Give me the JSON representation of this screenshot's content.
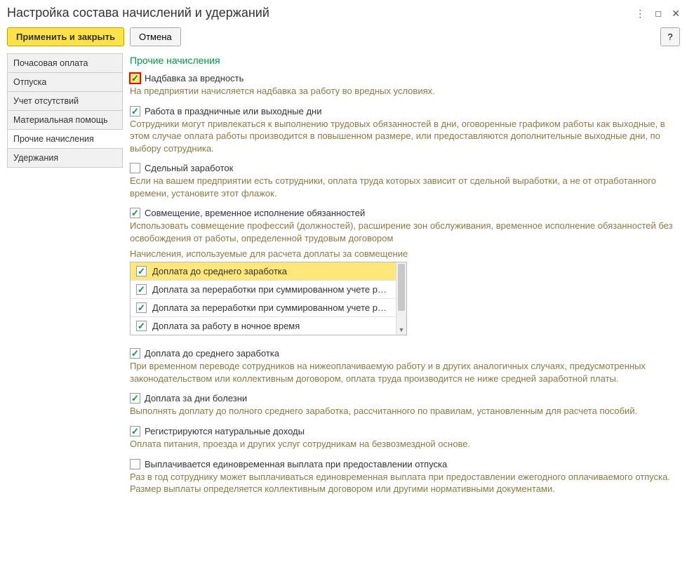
{
  "window": {
    "title": "Настройка состава начислений и удержаний"
  },
  "toolbar": {
    "apply_close": "Применить и закрыть",
    "cancel": "Отмена",
    "help": "?"
  },
  "sidebar": {
    "items": [
      {
        "label": "Почасовая оплата"
      },
      {
        "label": "Отпуска"
      },
      {
        "label": "Учет отсутствий"
      },
      {
        "label": "Материальная помощь"
      },
      {
        "label": "Прочие начисления"
      },
      {
        "label": "Удержания"
      }
    ],
    "active_index": 4
  },
  "main": {
    "heading": "Прочие начисления",
    "hazard": {
      "label": "Надбавка за вредность",
      "checked": true,
      "desc": "На предприятии начисляется надбавка за работу во вредных условиях."
    },
    "holiday": {
      "label": "Работа в праздничные или выходные дни",
      "checked": true,
      "desc": "Сотрудники могут привлекаться к выполнению трудовых обязанностей в дни, оговоренные графиком работы как выходные, в этом случае оплата работы производится в повышенном размере, или предоставляются дополнительные выходные дни, по выбору сотрудника."
    },
    "piecework": {
      "label": "Сдельный заработок",
      "checked": false,
      "desc": "Если на вашем предприятии есть сотрудники, оплата труда которых зависит от сдельной выработки, а не от отработанного времени, установите этот флажок."
    },
    "combine": {
      "label": "Совмещение, временное исполнение обязанностей",
      "checked": true,
      "desc": "Использовать совмещение профессий (должностей), расширение зон обслуживания, временное исполнение обязанностей без освобождения от работы, определенной трудовым договором",
      "sub_caption": "Начисления, используемые для расчета доплаты за совмещение",
      "list": [
        {
          "label": "Доплата до среднего заработка",
          "checked": true,
          "selected": true
        },
        {
          "label": "Доплата за переработки при суммированном учете ра...",
          "checked": true
        },
        {
          "label": "Доплата за переработки при суммированном учете ра...",
          "checked": true
        },
        {
          "label": "Доплата за работу в ночное время",
          "checked": true
        }
      ]
    },
    "avg_pay": {
      "label": "Доплата до среднего заработка",
      "checked": true,
      "desc": "При временном переводе сотрудников на нижеоплачиваемую работу и в других аналогичных случаях, предусмотренных законодательством или коллективным договором, оплата труда производится не ниже средней заработной платы."
    },
    "sick": {
      "label": "Доплата за дни болезни",
      "checked": true,
      "desc": "Выполнять доплату до полного среднего заработка, рассчитанного по правилам, установленным для расчета пособий."
    },
    "natural": {
      "label": "Регистрируются натуральные доходы",
      "checked": true,
      "desc": "Оплата питания, проезда и других услуг сотрудникам на безвозмездной основе."
    },
    "vacation_payout": {
      "label": "Выплачивается единовременная выплата при предоставлении отпуска",
      "checked": false,
      "desc": "Раз в год сотруднику может выплачиваться единовременная выплата при предоставлении ежегодного оплачиваемого отпуска. Размер выплаты определяется коллективным договором или другими нормативными документами."
    }
  }
}
